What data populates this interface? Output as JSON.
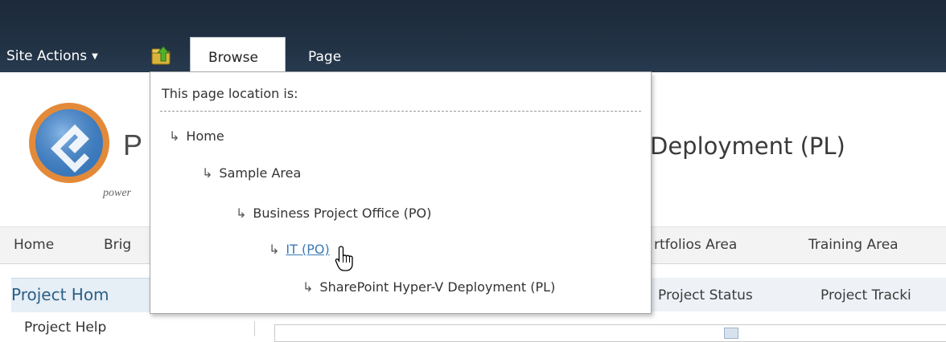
{
  "ribbon": {
    "site_actions": "Site Actions",
    "site_actions_caret": "▼",
    "tabs": [
      {
        "label": "Browse",
        "selected": true
      },
      {
        "label": "Page",
        "selected": false
      }
    ]
  },
  "header": {
    "logo_letter": "P",
    "tagline": "power",
    "site_title": "Deployment (PL)"
  },
  "topnav": {
    "items": [
      "Home",
      "Brig",
      "rtfolios Area",
      "Training Area"
    ]
  },
  "quicklaunch": {
    "header": "Project Hom",
    "items": [
      "Project Help"
    ]
  },
  "subnav": {
    "items": [
      "Project Status",
      "Project Tracki"
    ]
  },
  "dropdown": {
    "heading": "This page location is:",
    "arrow_glyph": "↳",
    "crumbs": [
      {
        "label": "Home",
        "level": 0,
        "is_link": false
      },
      {
        "label": "Sample Area",
        "level": 1,
        "is_link": false
      },
      {
        "label": "Business Project Office (PO)",
        "level": 2,
        "is_link": false
      },
      {
        "label": "IT (PO)",
        "level": 3,
        "is_link": true
      },
      {
        "label": "SharePoint Hyper-V Deployment (PL)",
        "level": 4,
        "is_link": false
      }
    ]
  },
  "colors": {
    "ribbon_bg": "#1f2e40",
    "link": "#3a7ab8",
    "quicklaunch_header": "#2c5f85"
  },
  "icons": {
    "navigate_up": "folder-up-arrow-icon",
    "cursor": "hand-pointer-icon",
    "logo": "brand-logo-icon"
  }
}
